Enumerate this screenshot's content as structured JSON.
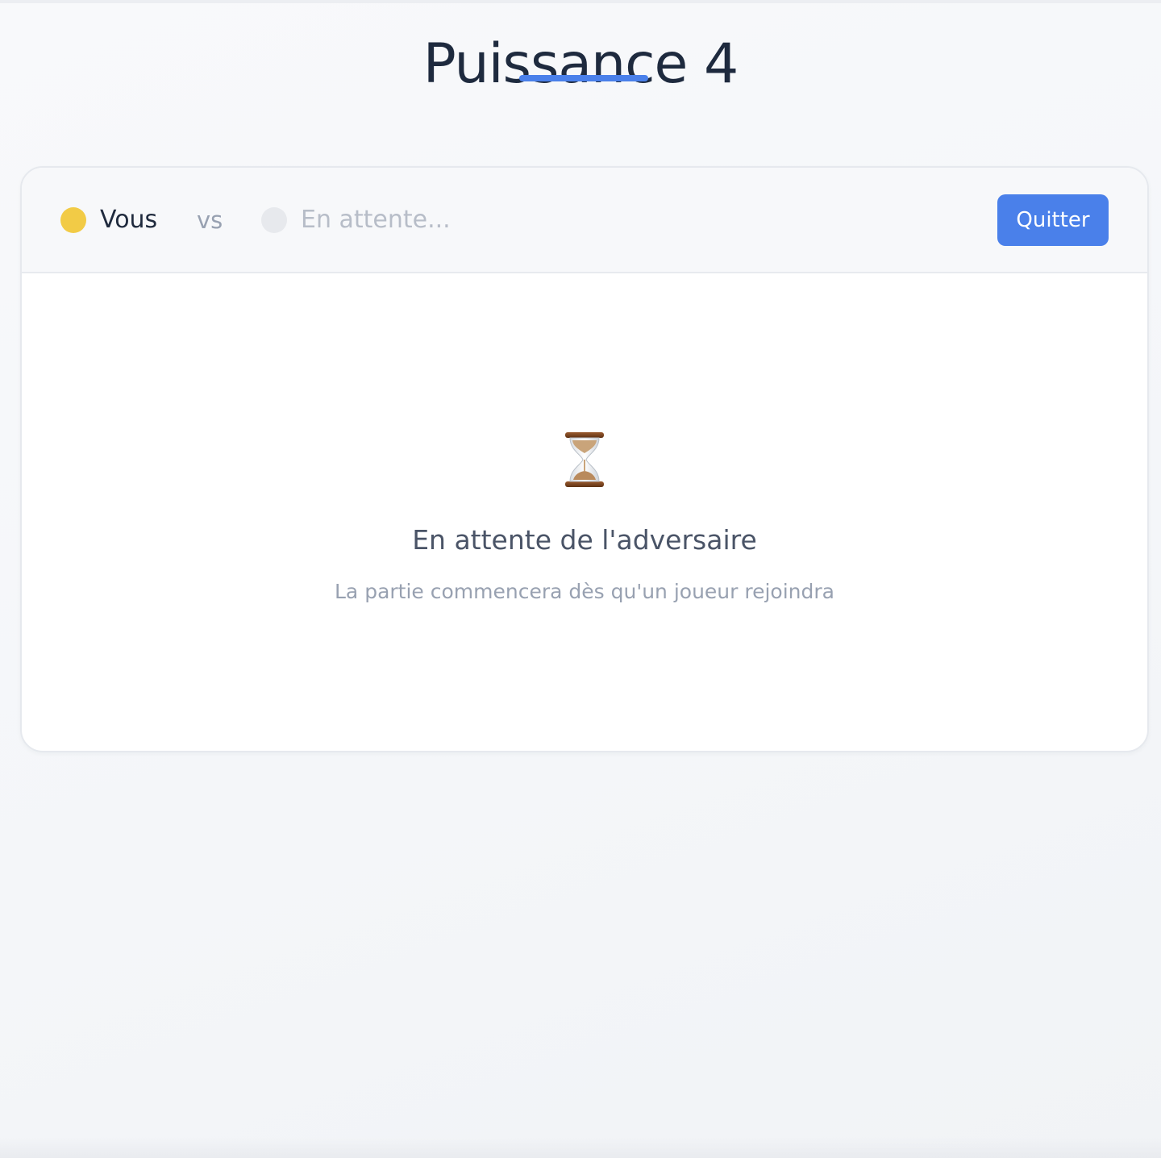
{
  "header": {
    "title": "Puissance 4"
  },
  "players": {
    "you": {
      "name": "Vous",
      "token_color": "#f2cb46",
      "text_color": "#1f2a3d"
    },
    "separator": "vs",
    "opponent": {
      "name": "En attente...",
      "token_color": "#e7e9ed",
      "text_color": "#b7bdc8"
    }
  },
  "actions": {
    "quit_label": "Quitter"
  },
  "waiting": {
    "icon": "hourglass-icon",
    "title": "En attente de l'adversaire",
    "subtitle": "La partie commencera dès qu'un joueur rejoindra"
  },
  "colors": {
    "accent": "#4a80ea",
    "underline": "#4a80ea"
  }
}
